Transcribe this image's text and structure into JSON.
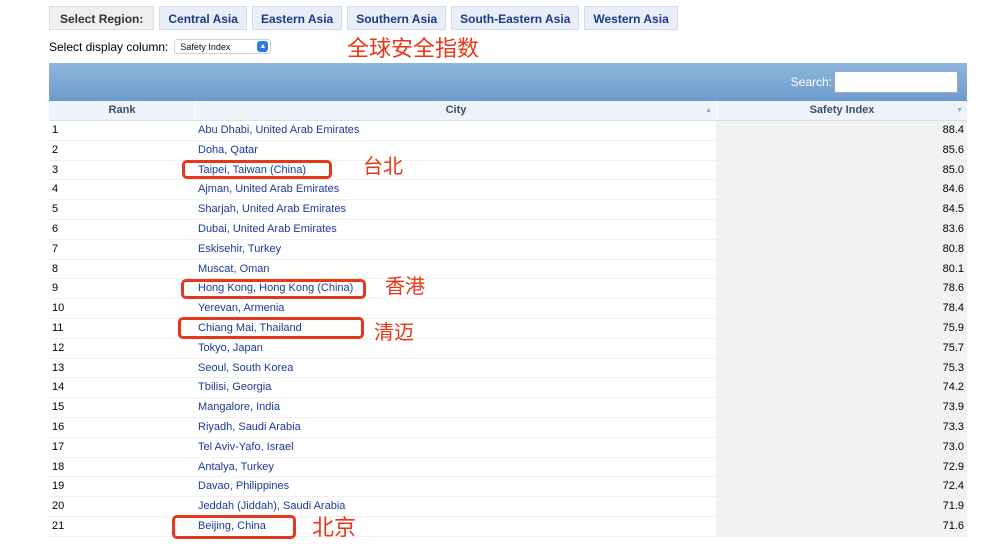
{
  "region_bar": {
    "label": "Select Region:",
    "buttons": [
      "Central Asia",
      "Eastern Asia",
      "Southern Asia",
      "South-Eastern Asia",
      "Western Asia"
    ]
  },
  "column_select": {
    "label": "Select display column:",
    "value": "Safety Index"
  },
  "annotations": {
    "title": "全球安全指数",
    "taipei": "台北",
    "hongkong": "香港",
    "chiangmai": "清迈",
    "beijing": "北京"
  },
  "search": {
    "label": "Search:",
    "value": ""
  },
  "table": {
    "headers": [
      "Rank",
      "City",
      "Safety Index"
    ],
    "rows": [
      {
        "rank": "1",
        "city": "Abu Dhabi, United Arab Emirates",
        "value": "88.4"
      },
      {
        "rank": "2",
        "city": "Doha, Qatar",
        "value": "85.6"
      },
      {
        "rank": "3",
        "city": "Taipei, Taiwan (China)",
        "value": "85.0"
      },
      {
        "rank": "4",
        "city": "Ajman, United Arab Emirates",
        "value": "84.6"
      },
      {
        "rank": "5",
        "city": "Sharjah, United Arab Emirates",
        "value": "84.5"
      },
      {
        "rank": "6",
        "city": "Dubai, United Arab Emirates",
        "value": "83.6"
      },
      {
        "rank": "7",
        "city": "Eskisehir, Turkey",
        "value": "80.8"
      },
      {
        "rank": "8",
        "city": "Muscat, Oman",
        "value": "80.1"
      },
      {
        "rank": "9",
        "city": "Hong Kong, Hong Kong (China)",
        "value": "78.6"
      },
      {
        "rank": "10",
        "city": "Yerevan, Armenia",
        "value": "78.4"
      },
      {
        "rank": "11",
        "city": "Chiang Mai, Thailand",
        "value": "75.9"
      },
      {
        "rank": "12",
        "city": "Tokyo, Japan",
        "value": "75.7"
      },
      {
        "rank": "13",
        "city": "Seoul, South Korea",
        "value": "75.3"
      },
      {
        "rank": "14",
        "city": "Tbilisi, Georgia",
        "value": "74.2"
      },
      {
        "rank": "15",
        "city": "Mangalore, India",
        "value": "73.9"
      },
      {
        "rank": "16",
        "city": "Riyadh, Saudi Arabia",
        "value": "73.3"
      },
      {
        "rank": "17",
        "city": "Tel Aviv-Yafo, Israel",
        "value": "73.0"
      },
      {
        "rank": "18",
        "city": "Antalya, Turkey",
        "value": "72.9"
      },
      {
        "rank": "19",
        "city": "Davao, Philippines",
        "value": "72.4"
      },
      {
        "rank": "20",
        "city": "Jeddah (Jiddah), Saudi Arabia",
        "value": "71.9"
      },
      {
        "rank": "21",
        "city": "Beijing, China",
        "value": "71.6"
      }
    ]
  },
  "colors": {
    "annotation": "#e8361a",
    "link": "#1a3a9a",
    "header_band": "#7ea8d4"
  }
}
